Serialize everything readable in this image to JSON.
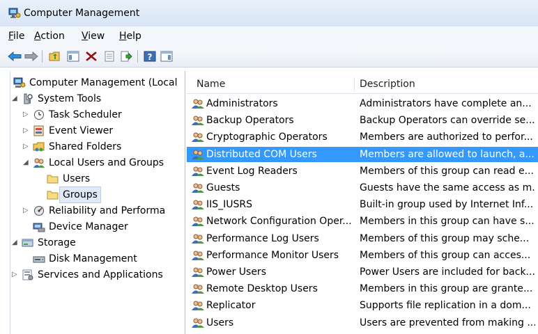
{
  "window": {
    "title": "Computer Management"
  },
  "menu": [
    {
      "underline": "F",
      "rest": "ile"
    },
    {
      "underline": "A",
      "rest": "ction"
    },
    {
      "underline": "V",
      "rest": "iew"
    },
    {
      "underline": "H",
      "rest": "elp"
    }
  ],
  "toolbar": {
    "buttons": [
      "back-icon",
      "forward-icon",
      "up-folder-icon",
      "show-hide-console-tree-icon",
      "delete-icon",
      "properties-icon",
      "export-list-icon",
      "help-icon",
      "show-hide-action-pane-icon"
    ]
  },
  "tree": [
    {
      "label": "Computer Management (Local",
      "icon": "computer-management-icon",
      "level": 0,
      "arrow": ""
    },
    {
      "label": "System Tools",
      "icon": "system-tools-icon",
      "level": 1,
      "arrow": "expanded"
    },
    {
      "label": "Task Scheduler",
      "icon": "clock-icon",
      "level": 2,
      "arrow": "collapsed"
    },
    {
      "label": "Event Viewer",
      "icon": "event-viewer-icon",
      "level": 2,
      "arrow": "collapsed"
    },
    {
      "label": "Shared Folders",
      "icon": "shared-folder-icon",
      "level": 2,
      "arrow": "collapsed"
    },
    {
      "label": "Local Users and Groups",
      "icon": "users-groups-icon",
      "level": 2,
      "arrow": "expanded"
    },
    {
      "label": "Users",
      "icon": "folder-icon",
      "level": 3,
      "arrow": ""
    },
    {
      "label": "Groups",
      "icon": "folder-icon",
      "level": 3,
      "arrow": "",
      "selected": true
    },
    {
      "label": "Reliability and Performa",
      "icon": "performance-icon",
      "level": 2,
      "arrow": "collapsed"
    },
    {
      "label": "Device Manager",
      "icon": "device-manager-icon",
      "level": 2,
      "arrow": ""
    },
    {
      "label": "Storage",
      "icon": "storage-icon",
      "level": 1,
      "arrow": "expanded"
    },
    {
      "label": "Disk Management",
      "icon": "disk-icon",
      "level": 2,
      "arrow": ""
    },
    {
      "label": "Services and Applications",
      "icon": "services-icon",
      "level": 1,
      "arrow": "collapsed"
    }
  ],
  "list": {
    "columns": [
      "Name",
      "Description"
    ],
    "rows": [
      {
        "name": "Administrators",
        "desc": "Administrators have complete an..."
      },
      {
        "name": "Backup Operators",
        "desc": "Backup Operators can override se..."
      },
      {
        "name": "Cryptographic Operators",
        "desc": "Members are authorized to perfor..."
      },
      {
        "name": "Distributed COM Users",
        "desc": "Members are allowed to launch, a...",
        "selected": true
      },
      {
        "name": "Event Log Readers",
        "desc": "Members of this group can read e..."
      },
      {
        "name": "Guests",
        "desc": "Guests have the same access as m..."
      },
      {
        "name": "IIS_IUSRS",
        "desc": "Built-in group used by Internet Inf..."
      },
      {
        "name": "Network Configuration Oper...",
        "desc": "Members in this group can have s..."
      },
      {
        "name": "Performance Log Users",
        "desc": "Members of this group may sche..."
      },
      {
        "name": "Performance Monitor Users",
        "desc": "Members of this group can acces..."
      },
      {
        "name": "Power Users",
        "desc": "Power Users are included for back..."
      },
      {
        "name": "Remote Desktop Users",
        "desc": "Members in this group are grante..."
      },
      {
        "name": "Replicator",
        "desc": "Supports file replication in a dom..."
      },
      {
        "name": "Users",
        "desc": "Users are prevented from making ..."
      }
    ]
  },
  "colors": {
    "selection": "#3399ff",
    "titlebar": "#d6e5f6"
  }
}
